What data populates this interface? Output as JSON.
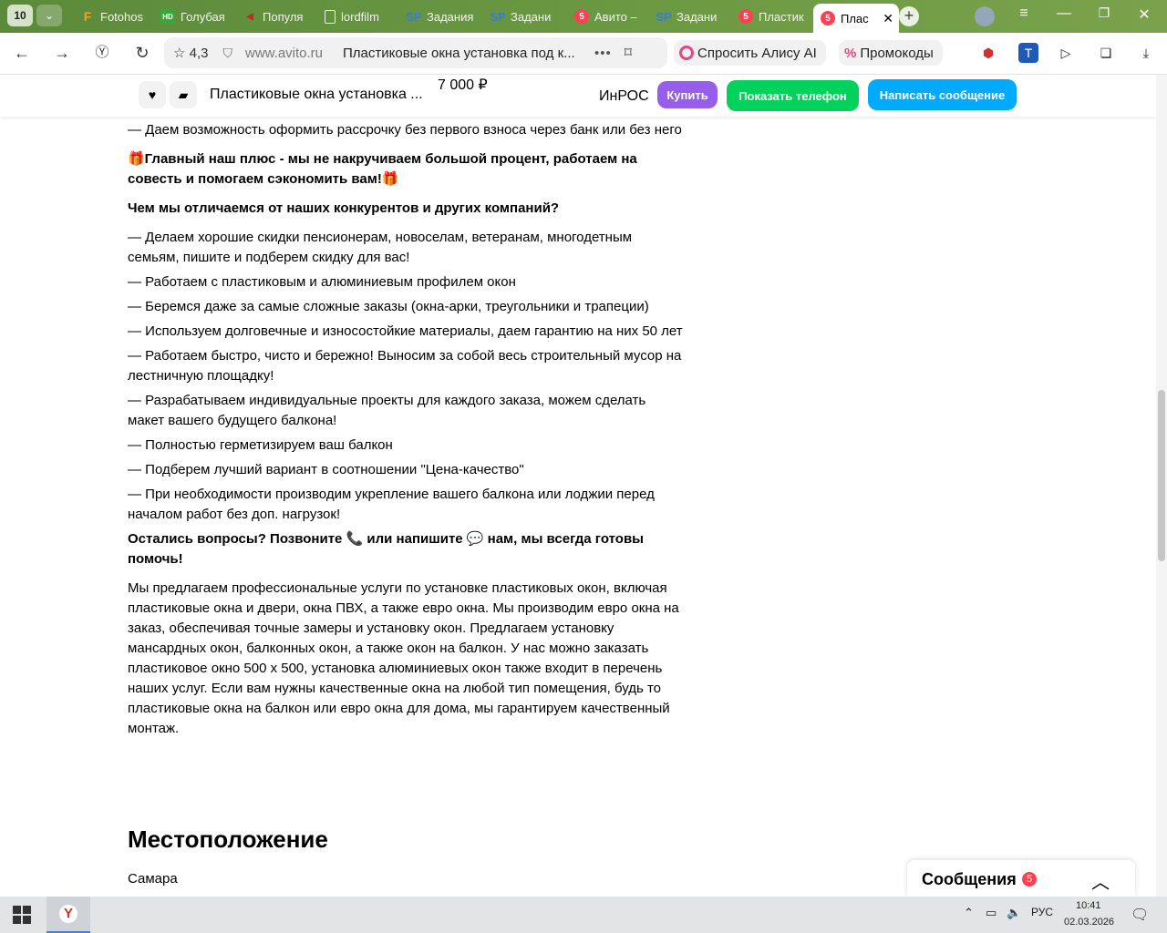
{
  "browser": {
    "tab_count": "10",
    "tabs": [
      {
        "label": "Fotohos",
        "fav_text": "F",
        "fav_color": "#f0a12a"
      },
      {
        "label": "Голубая",
        "fav_text": "HD",
        "fav_color": "#3aa63a"
      },
      {
        "label": "Популя",
        "fav_text": "◀",
        "fav_color": "#c62828"
      },
      {
        "label": "lordfilm",
        "fav_text": "▯",
        "fav_color": "#dfe8d6"
      },
      {
        "label": "Задания",
        "fav_text": "SP",
        "fav_color": "#3a7bd5"
      },
      {
        "label": "Задани",
        "fav_text": "SP",
        "fav_color": "#3a7bd5"
      },
      {
        "label": "Авито –",
        "fav_text": "5",
        "fav_color": "#ff4053"
      },
      {
        "label": "Задани",
        "fav_text": "SP",
        "fav_color": "#3a7bd5"
      },
      {
        "label": "Пластик",
        "fav_text": "5",
        "fav_color": "#ff4053"
      },
      {
        "label": "Плас",
        "fav_text": "5",
        "fav_color": "#ff4053"
      }
    ],
    "rating": "4,3",
    "domain": "www.avito.ru",
    "page_title": "Пластиковые окна установка под к...",
    "alice_label": "Спросить Алису AI",
    "promo_label": "Промокоды"
  },
  "sticky": {
    "title": "Пластиковые окна установка ...",
    "price": "7 000 ₽",
    "seller": "ИнРОС",
    "buy_label": "Купить",
    "phone_label": "Показать телефон",
    "message_label": "Написать сообщение",
    "colors": {
      "buy": "#965eeb",
      "phone": "#02d15c",
      "message": "#00aaff"
    }
  },
  "description": {
    "p1": "— Даем возможность оформить рассрочку без первого взноса через банк или без него",
    "p2": "🎁Главный наш плюс - мы не накручиваем большой процент, работаем на совесть и помогаем сэкономить вам!🎁",
    "p3": "Чем мы отличаемся от наших конкурентов и других компаний?",
    "items": [
      "— Делаем хорошие скидки пенсионерам, новоселам, ветеранам, многодетным семьям, пишите и подберем скидку для вас!",
      "— Работаем с пластиковым и алюминиевым профилем окон",
      "— Беремся даже за самые сложные заказы (окна-арки, треугольники и трапеции)",
      "— Используем долговечные и износостойкие материалы, даем гарантию на них 50 лет",
      "— Работаем быстро, чисто и бережно! Выносим за собой весь строительный мусор на лестничную площадку!",
      "— Разрабатываем индивидуальные проекты для каждого заказа, можем сделать макет вашего будущего балкона!",
      "— Полностью герметизируем ваш балкон",
      "— Подберем лучший вариант в соотношении \"Цена-качество\"",
      "— При необходимости производим укрепление вашего балкона или лоджии перед началом работ без доп. нагрузок!"
    ],
    "p4": "Остались вопросы? Позвоните 📞 или напишите 💬 нам, мы всегда готовы помочь!",
    "p5": "Мы предлагаем профессиональные услуги по установке пластиковых окон, включая пластиковые окна и двери, окна ПВХ, а также евро окна. Мы производим евро окна на заказ, обеспечивая точные замеры и установку окон. Предлагаем установку мансардных окон, балконных окон, а также окон на балкон. У нас можно заказать пластиковое окно 500 х 500, установка алюминиевых окон также входит в перечень наших услуг. Если вам нужны качественные окна на любой тип помещения, будь то пластиковые окна на балкон или евро окна для дома, мы гарантируем качественный монтаж."
  },
  "location": {
    "heading": "Местоположение",
    "city": "Самара"
  },
  "messages": {
    "label": "Сообщения",
    "count": "5"
  },
  "taskbar": {
    "lang": "РУС",
    "time": "10:41",
    "date": "02.03.2026"
  }
}
